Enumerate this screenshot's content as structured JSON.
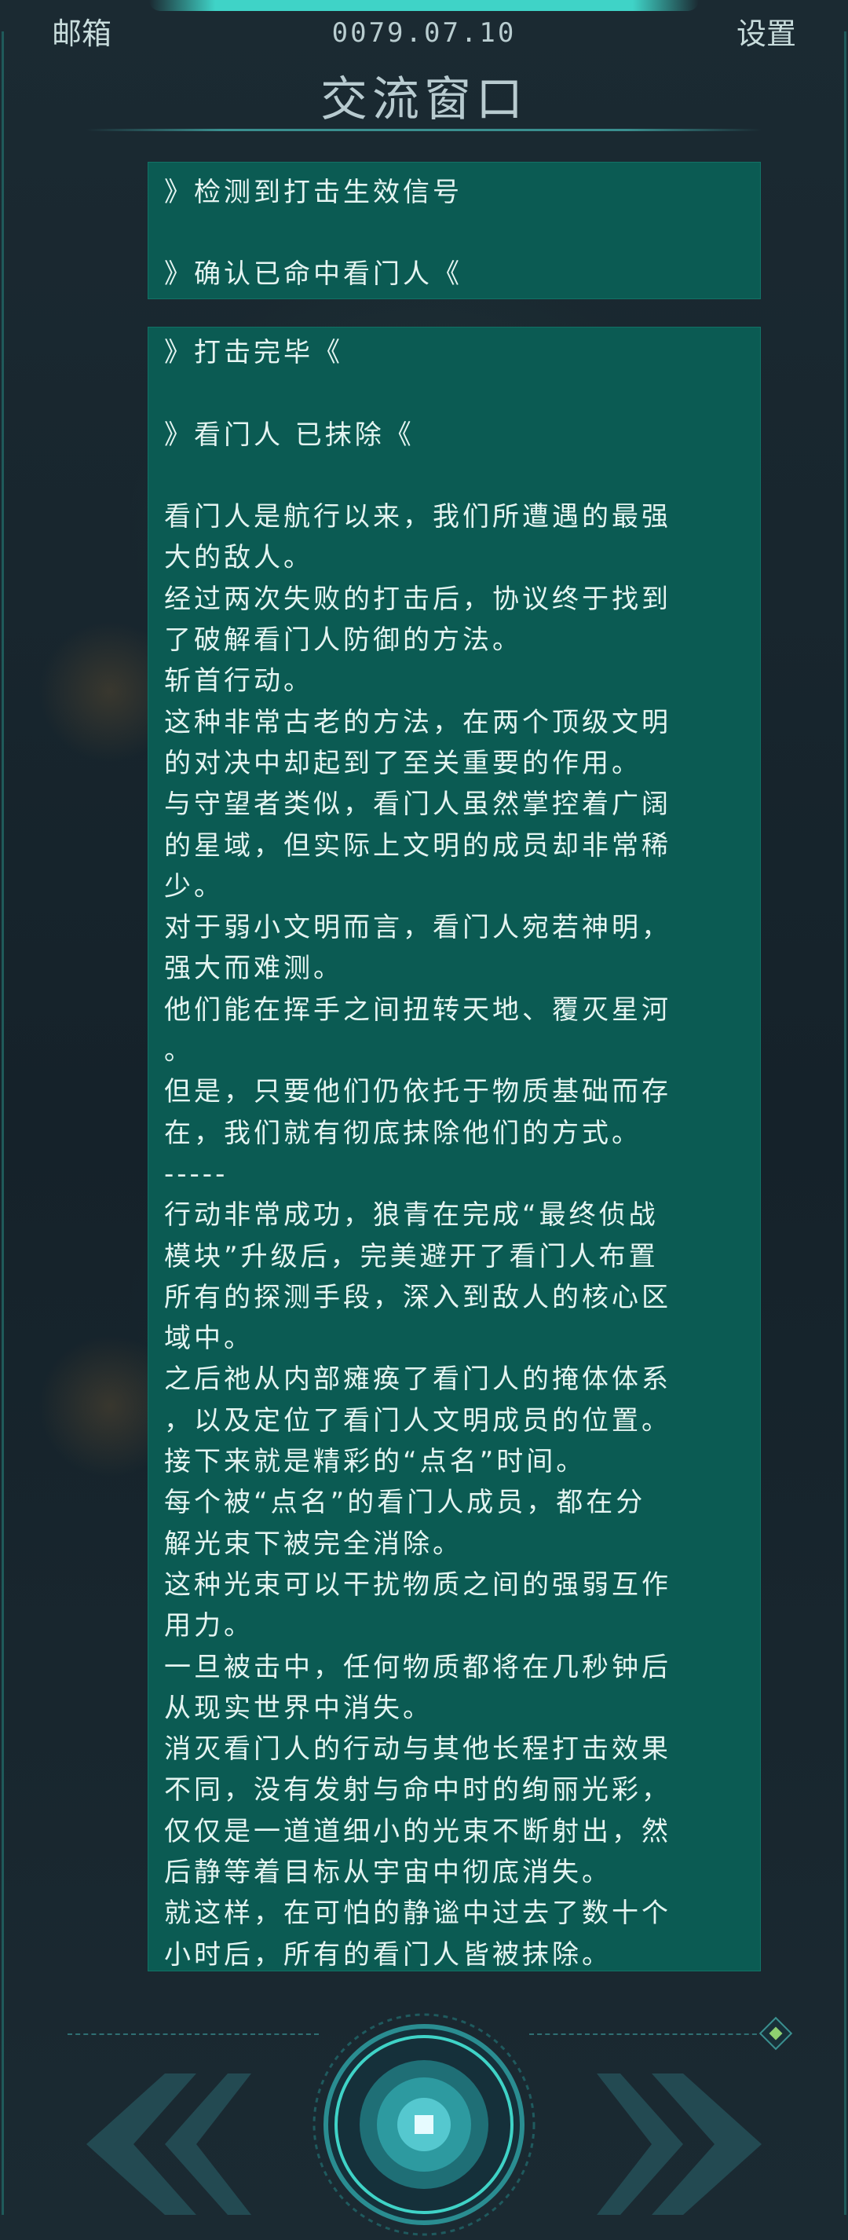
{
  "header": {
    "mailbox_label": "邮箱",
    "date": "0079.07.10",
    "settings_label": "设置",
    "title": "交流窗口"
  },
  "messages": [
    {
      "lines": [
        "》检测到打击生效信号",
        "",
        "》确认已命中看门人《"
      ]
    },
    {
      "lines": [
        "》打击完毕《",
        "",
        "》看门人 已抹除《",
        "",
        "看门人是航行以来，我们所遭遇的最强",
        "大的敌人。",
        "经过两次失败的打击后，协议终于找到",
        "了破解看门人防御的方法。",
        "斩首行动。",
        "这种非常古老的方法，在两个顶级文明",
        "的对决中却起到了至关重要的作用。",
        "与守望者类似，看门人虽然掌控着广阔",
        "的星域，但实际上文明的成员却非常稀",
        "少。",
        "对于弱小文明而言，看门人宛若神明，",
        "强大而难测。",
        "他们能在挥手之间扭转天地、覆灭星河",
        "。",
        "但是，只要他们仍依托于物质基础而存",
        "在，我们就有彻底抹除他们的方式。",
        "-----",
        "行动非常成功，狼青在完成“最终侦战",
        "模块”升级后，完美避开了看门人布置",
        "所有的探测手段，深入到敌人的核心区",
        "域中。",
        "之后祂从内部瘫痪了看门人的掩体体系",
        "，以及定位了看门人文明成员的位置。",
        "接下来就是精彩的“点名”时间。",
        "每个被“点名”的看门人成员，都在分",
        "解光束下被完全消除。",
        "这种光束可以干扰物质之间的强弱互作",
        "用力。",
        "一旦被击中，任何物质都将在几秒钟后",
        "从现实世界中消失。",
        "消灭看门人的行动与其他长程打击效果",
        "不同，没有发射与命中时的绚丽光彩，",
        "仅仅是一道道细小的光束不断射出，然",
        "后静等着目标从宇宙中彻底消失。",
        "就这样，在可怕的静谧中过去了数十个",
        "小时后，所有的看门人皆被抹除。"
      ]
    }
  ],
  "icons": {
    "prev": "double-chevron-left-icon",
    "next": "double-chevron-right-icon",
    "center": "record-button-icon",
    "corner": "diamond-indicator-icon"
  },
  "colors": {
    "background": "#16232b",
    "message_bg": "#0b5b53",
    "accent": "#3fd3c7"
  }
}
